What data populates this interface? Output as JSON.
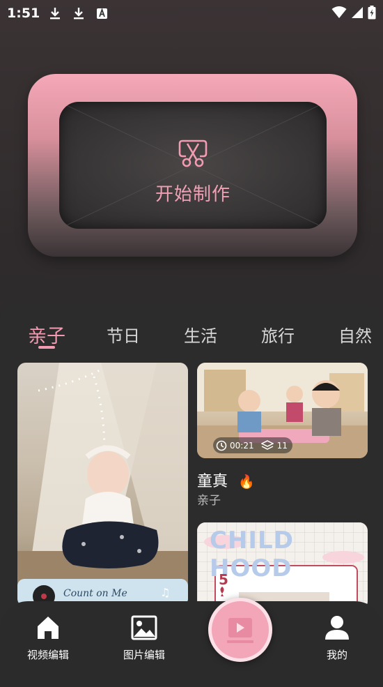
{
  "status_bar": {
    "time": "1:51",
    "left_icons": [
      "download-icon",
      "download-icon",
      "text-a-icon"
    ],
    "right_icons": [
      "wifi-icon",
      "signal-icon",
      "battery-charging-icon"
    ]
  },
  "hero": {
    "label": "开始制作",
    "icon": "scissors-icon"
  },
  "tabs": [
    {
      "label": "亲子",
      "active": true
    },
    {
      "label": "节日",
      "active": false
    },
    {
      "label": "生活",
      "active": false
    },
    {
      "label": "旅行",
      "active": false
    },
    {
      "label": "自然",
      "active": false
    }
  ],
  "cards": {
    "baby": {
      "overlay_text": "Count on Me"
    },
    "kids": {
      "duration": "00:21",
      "layers": "11",
      "title": "童真",
      "title_icon": "fire-icon",
      "subtitle": "亲子"
    },
    "childhood": {
      "overlay_text": "CHILD HOOD",
      "card_number": "5"
    }
  },
  "nav": {
    "items": [
      {
        "label": "视频编辑",
        "icon": "home-icon"
      },
      {
        "label": "图片编辑",
        "icon": "image-icon"
      },
      {
        "label": "",
        "icon": "play-icon"
      },
      {
        "label": "我的",
        "icon": "user-icon"
      }
    ]
  },
  "colors": {
    "accent": "#f29bb2",
    "background": "#2c2c2c",
    "hero_pink": "#f5a8b8"
  }
}
